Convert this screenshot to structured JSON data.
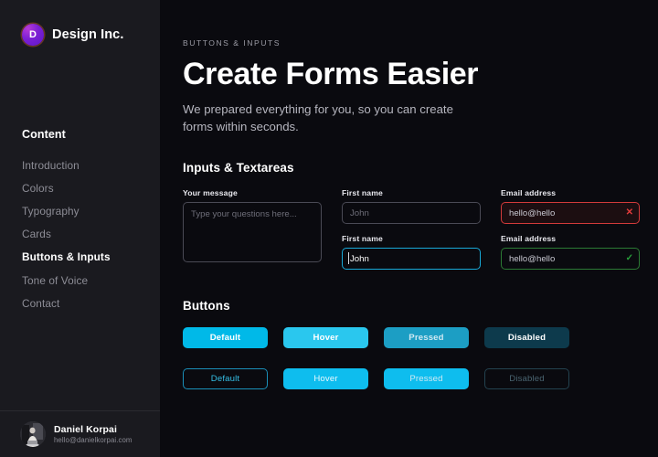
{
  "theme": {
    "sidebar_bg": "#1a1a1f",
    "main_bg": "#0a0a0f",
    "accent": "#00b9e8",
    "accent_hover": "#2ac7ee",
    "accent_pressed": "#1c9ec4",
    "accent_disabled": "#0d3a4c",
    "error": "#d33a3a",
    "success": "#2c7a34",
    "text_primary": "#ffffff",
    "text_muted": "#8d8d96",
    "logo_purple": "#7b1fd4"
  },
  "sidebar": {
    "brand": {
      "logo_letter": "D",
      "logo_icon": "brand-avatar-icon",
      "name": "Design Inc."
    },
    "nav_heading": "Content",
    "items": [
      {
        "label": "Introduction",
        "active": false
      },
      {
        "label": "Colors",
        "active": false
      },
      {
        "label": "Typography",
        "active": false
      },
      {
        "label": "Cards",
        "active": false
      },
      {
        "label": "Buttons & Inputs",
        "active": true
      },
      {
        "label": "Tone of Voice",
        "active": false
      },
      {
        "label": "Contact",
        "active": false
      }
    ],
    "footer": {
      "avatar_icon": "user-photo-avatar-icon",
      "name": "Daniel Korpai",
      "email": "hello@danielkorpai.com"
    }
  },
  "main": {
    "eyebrow": "BUTTONS & INPUTS",
    "title": "Create Forms Easier",
    "subtitle": "We prepared everything for you, so you can create forms within seconds.",
    "inputs_section": {
      "title": "Inputs & Textareas",
      "fields": [
        {
          "label": "First name",
          "value": "",
          "placeholder": "John",
          "state": "default",
          "icon": ""
        },
        {
          "label": "Email address",
          "value": "hello@hello",
          "placeholder": "",
          "state": "error",
          "icon": "error-x-icon",
          "icon_glyph": "✕"
        },
        {
          "label": "First name",
          "value": "John",
          "placeholder": "",
          "state": "focused",
          "icon": ""
        },
        {
          "label": "Email address",
          "value": "hello@hello",
          "placeholder": "",
          "state": "success",
          "icon": "success-check-icon",
          "icon_glyph": "✓"
        }
      ],
      "textarea": {
        "label": "Your message",
        "value": "",
        "placeholder": "Type your questions here..."
      }
    },
    "buttons_section": {
      "title": "Buttons",
      "primary_row": [
        {
          "label": "Default",
          "state": "default"
        },
        {
          "label": "Hover",
          "state": "hover"
        },
        {
          "label": "Pressed",
          "state": "pressed"
        },
        {
          "label": "Disabled",
          "state": "disabled"
        }
      ],
      "secondary_row": [
        {
          "label": "Default",
          "state": "default"
        },
        {
          "label": "Hover",
          "state": "hover"
        },
        {
          "label": "Pressed",
          "state": "pressed"
        },
        {
          "label": "Disabled",
          "state": "disabled"
        }
      ]
    }
  }
}
